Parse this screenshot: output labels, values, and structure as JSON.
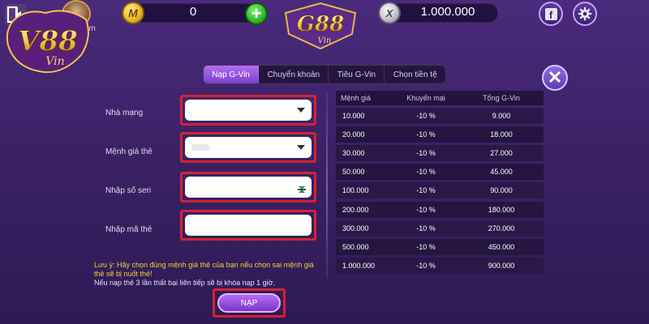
{
  "topbar": {
    "username_fragment": "em",
    "gold_icon_letter": "M",
    "gold_balance": "0",
    "add_symbol": "+",
    "silver_icon_letter": "X",
    "silver_balance": "1.000.000",
    "facebook_letter": "f"
  },
  "brand": {
    "left_logo_text": "V88",
    "left_logo_sub": "Vin",
    "center_logo_text": "G88",
    "center_logo_sub": "Vin"
  },
  "tabs": [
    {
      "label": "Nạp G-Vin",
      "active": true
    },
    {
      "label": "Chuyển khoản",
      "active": false
    },
    {
      "label": "Tiêu G-Vin",
      "active": false
    },
    {
      "label": "Chọn tiền tệ",
      "active": false
    }
  ],
  "close_symbol": "✕",
  "form": {
    "network_label": "Nhà mạng",
    "denomination_label": "Mệnh giá thẻ",
    "serial_label": "Nhập số seri",
    "code_label": "Nhập mã thẻ",
    "network_value": "",
    "serial_value": "",
    "code_value": ""
  },
  "note": {
    "highlight": "Lưu ý: Hãy chọn đúng mệnh giá thẻ của bạn nếu chọn sai mệnh giá thẻ sẽ bị nuốt thẻ!",
    "warning": "Nếu nạp thẻ 3 lần thất bại liên tiếp sẽ bị khóa nạp 1 giờ."
  },
  "submit_label": "NẠP",
  "rate_table": {
    "headers": [
      "Mệnh giá",
      "Khuyến mại",
      "Tổng G-Vin"
    ],
    "rows": [
      [
        "10.000",
        "-10 %",
        "9.000"
      ],
      [
        "20.000",
        "-10 %",
        "18.000"
      ],
      [
        "30.000",
        "-10 %",
        "27.000"
      ],
      [
        "50.000",
        "-10 %",
        "45.000"
      ],
      [
        "100.000",
        "-10 %",
        "90.000"
      ],
      [
        "200.000",
        "-10 %",
        "180.000"
      ],
      [
        "300.000",
        "-10 %",
        "270.000"
      ],
      [
        "500.000",
        "-10 %",
        "450.000"
      ],
      [
        "1.000.000",
        "-10 %",
        "900.000"
      ]
    ]
  },
  "colors": {
    "accent_purple": "#9b52e0",
    "highlight_red": "#d4232f",
    "note_yellow": "#f2d23a",
    "gold": "#f3c233",
    "add_green": "#2fb82a"
  }
}
